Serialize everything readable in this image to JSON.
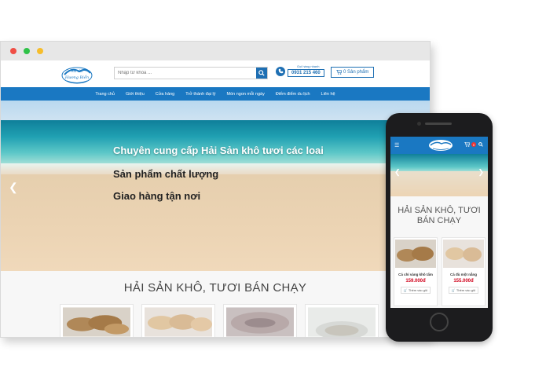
{
  "desktop": {
    "search_placeholder": "Nhập từ khóa ...",
    "hotline_label": "Gọi hàng nhanh",
    "hotline_number": "0931 215 460",
    "cart_label": "0 Sản phẩm",
    "nav": [
      "Trang chủ",
      "Giới thiệu",
      "Cửa hàng",
      "Trở thành đại lý",
      "Món ngon mỗi ngày",
      "Điểm điểm du lịch",
      "Liên hệ"
    ],
    "hero_lines": [
      "Chuyên cung cấp Hải Sản khô tươi các loai",
      "Sản phẩm chất lượng",
      "Giao hàng tận nơi"
    ],
    "section_title": "HẢI SẢN KHÔ, TƯƠI BÁN CHẠY"
  },
  "mobile": {
    "cart_count": "0",
    "section_title": "HẢI SẢN KHÔ, TƯƠI BÁN CHẠY",
    "products": [
      {
        "name": "Cá chỉ vàng khô tẩm",
        "price": "159.000đ",
        "add": "Thêm vào giỏ"
      },
      {
        "name": "Cá đù một nắng",
        "price": "155.000đ",
        "add": "Thêm vào giỏ"
      }
    ]
  }
}
